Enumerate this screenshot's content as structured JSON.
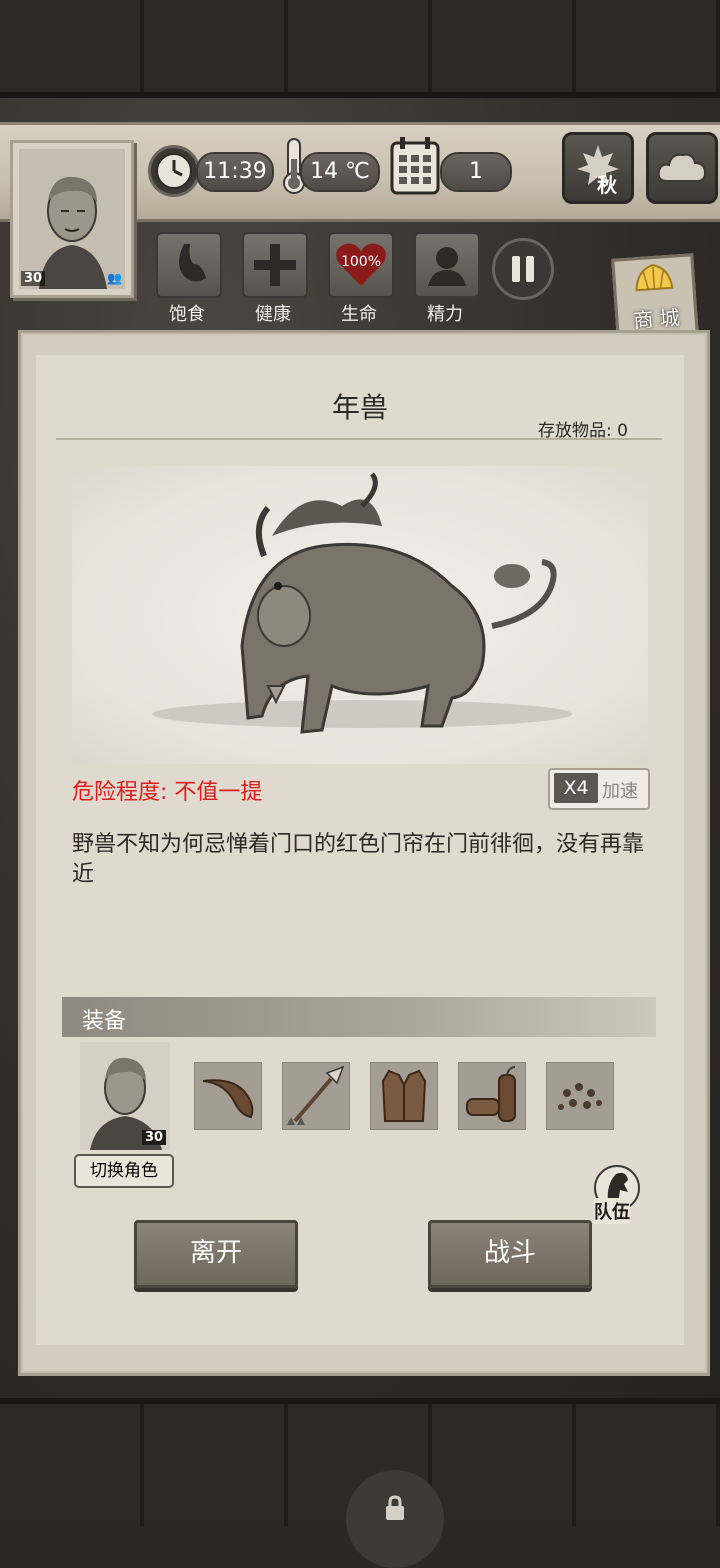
{
  "status": {
    "time": "11:39",
    "temperature": "14 ℃",
    "day": "1",
    "season": "秋",
    "character_level": "30"
  },
  "gauges": [
    {
      "label": "饱食",
      "icon": "stomach-icon"
    },
    {
      "label": "健康",
      "icon": "cross-icon"
    },
    {
      "label": "生命",
      "icon": "heart-icon",
      "value": "100%"
    },
    {
      "label": "精力",
      "icon": "person-icon"
    }
  ],
  "shop": {
    "label": "商 城"
  },
  "dialog": {
    "title": "年兽",
    "storage": "存放物品: 0",
    "danger": "危险程度: 不值一提",
    "speed_multiplier": "X4",
    "speed_label": "加速",
    "description": "野兽不知为何忌惮着门口的红色门帘在门前徘徊，没有再靠近"
  },
  "equipment": {
    "header": "装备",
    "character_level": "30",
    "switch_label": "切换角色",
    "team_label": "队伍",
    "slots": [
      {
        "icon": "horn-icon"
      },
      {
        "icon": "spear-icon"
      },
      {
        "icon": "vest-icon"
      },
      {
        "icon": "firecracker-icon"
      },
      {
        "icon": "pellets-icon"
      }
    ]
  },
  "actions": {
    "leave": "离开",
    "fight": "战斗"
  },
  "colors": {
    "danger": "#e01b1b",
    "heart": "#8b1a1a"
  }
}
